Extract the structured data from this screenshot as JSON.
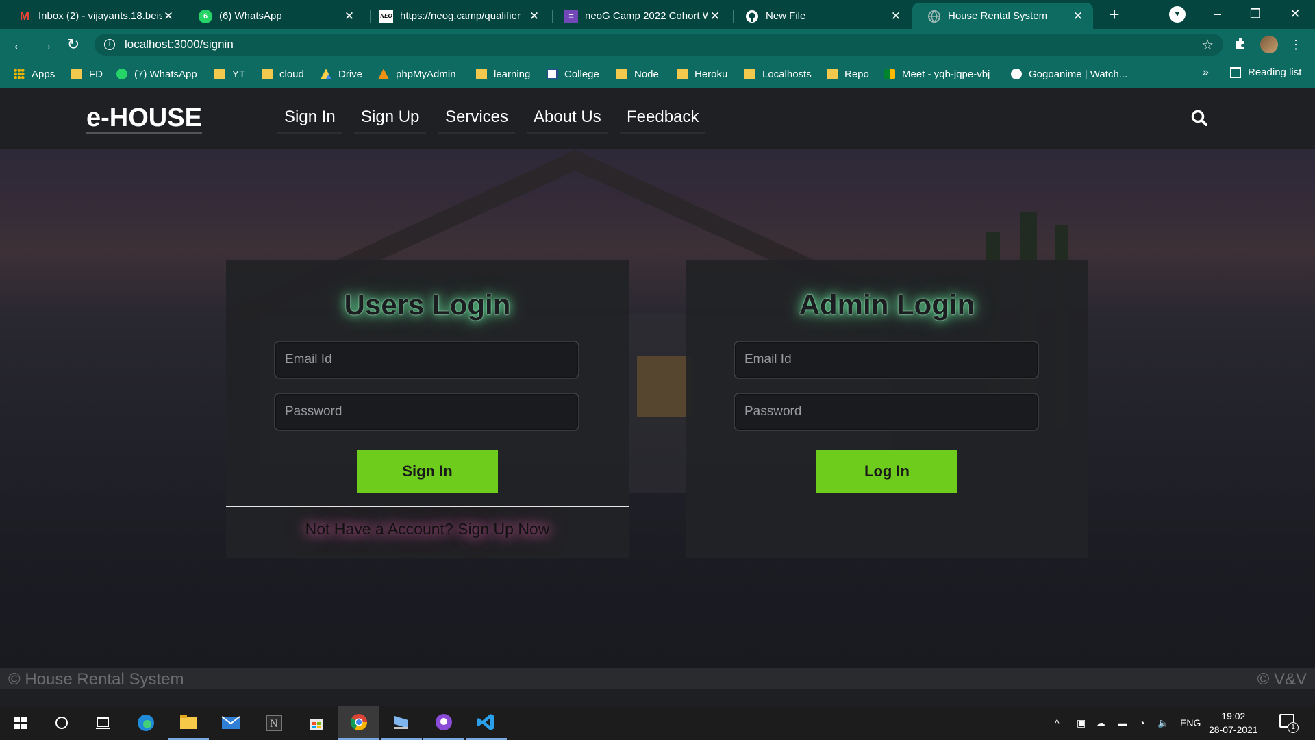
{
  "browser": {
    "tabs": [
      {
        "title": "Inbox (2) - vijayants.18.beis@",
        "icon": "gmail-icon",
        "fav": "M",
        "favColor": "#ea4335"
      },
      {
        "title": "(6) WhatsApp",
        "icon": "whatsapp-icon",
        "fav": "6",
        "favColor": "#25d366"
      },
      {
        "title": "https://neog.camp/qualifier",
        "icon": "neog-icon",
        "fav": "NEO",
        "favColor": "#111111"
      },
      {
        "title": "neoG Camp 2022 Cohort W",
        "icon": "forms-icon",
        "fav": "≡",
        "favColor": "#7248b9"
      },
      {
        "title": "New File",
        "icon": "github-icon",
        "fav": "●",
        "favColor": "#ffffff"
      },
      {
        "title": "House Rental System",
        "icon": "globe-icon",
        "fav": "◌",
        "favColor": "#9fb8b5"
      }
    ],
    "url": "localhost:3000/signin",
    "bookmarks": [
      {
        "label": "Apps",
        "icon": "apps"
      },
      {
        "label": "FD",
        "icon": "folder"
      },
      {
        "label": "(7) WhatsApp",
        "icon": "wa"
      },
      {
        "label": "YT",
        "icon": "folder"
      },
      {
        "label": "cloud",
        "icon": "folder"
      },
      {
        "label": "Drive",
        "icon": "drive"
      },
      {
        "label": "phpMyAdmin",
        "icon": "pma"
      },
      {
        "label": "learning",
        "icon": "folder"
      },
      {
        "label": "College",
        "icon": "college"
      },
      {
        "label": "Node",
        "icon": "folder"
      },
      {
        "label": "Heroku",
        "icon": "folder"
      },
      {
        "label": "Localhosts",
        "icon": "folder"
      },
      {
        "label": "Repo",
        "icon": "folder"
      },
      {
        "label": "Meet - yqb-jqpe-vbj",
        "icon": "meet"
      },
      {
        "label": "Gogoanime | Watch...",
        "icon": "gogo"
      }
    ],
    "bookmarks_more": "»",
    "reading_list": "Reading list"
  },
  "site": {
    "brand": "e-HOUSE",
    "nav": [
      "Sign In",
      "Sign Up",
      "Services",
      "About Us",
      "Feedback"
    ],
    "users_card": {
      "title": "Users Login",
      "email_placeholder": "Email Id",
      "password_placeholder": "Password",
      "button": "Sign In",
      "signup_link": "Not Have a Account? Sign Up Now"
    },
    "admin_card": {
      "title": "Admin Login",
      "email_placeholder": "Email Id",
      "password_placeholder": "Password",
      "button": "Log In"
    },
    "footer_left": "© House Rental System",
    "footer_right": "© V&V"
  },
  "taskbar": {
    "lang": "ENG",
    "time": "19:02",
    "date": "28-07-2021",
    "notifications": "1"
  },
  "colors": {
    "chrome_frame": "#04453f",
    "chrome_toolbar": "#0e6b62",
    "button_green": "#6ecc1d",
    "title_glow": "#6effaa",
    "link_glow": "#ff6ebe"
  }
}
